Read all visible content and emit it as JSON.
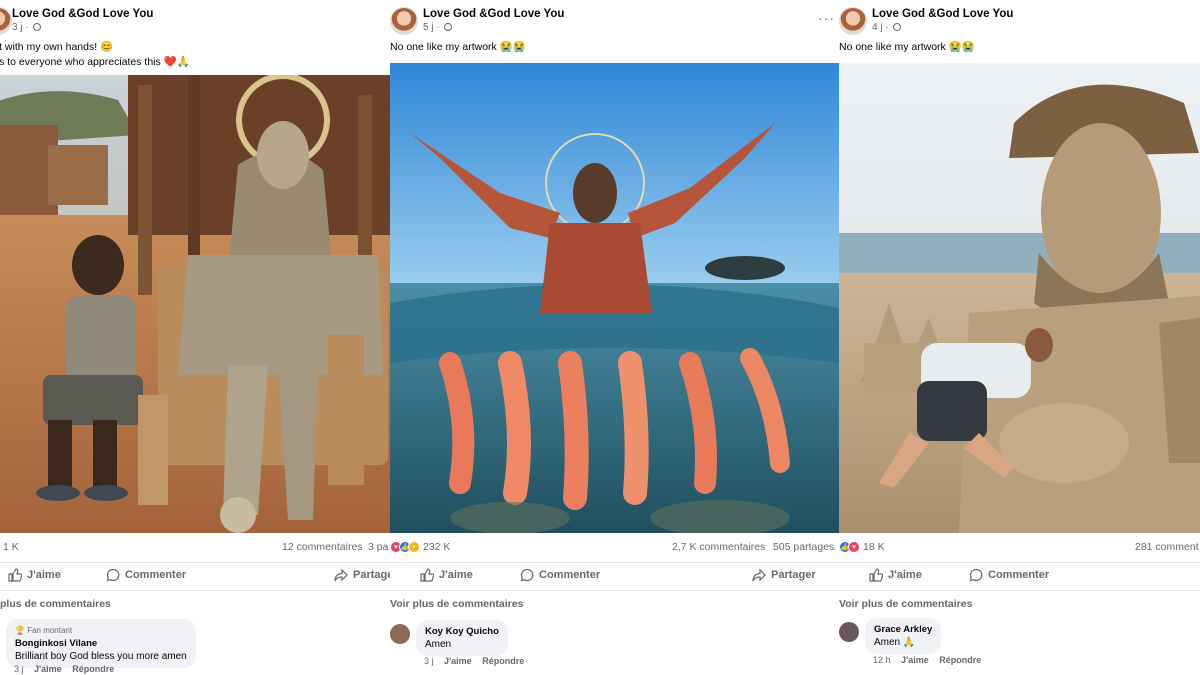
{
  "posts": [
    {
      "author": "Love God &God Love You",
      "time": "3 j",
      "caption_lines": [
        "e it with my own hands! 😊",
        "nks to everyone who appreciates this ❤️🙏"
      ],
      "image_desc": "coin-statue-photo",
      "reaction_count": "1 K",
      "comment_count": "12 commentaires",
      "share_count": "3 pa",
      "like_label": "J'aime",
      "comment_label": "Commenter",
      "share_label": "Partage",
      "more_comments": "plus de commentaires",
      "comment": {
        "badge": "Fan montant",
        "author": "Bonginkosi Vilane",
        "text": "Brilliant boy God bless you more amen",
        "time": "3 j",
        "like": "J'aime",
        "reply": "Répondre"
      }
    },
    {
      "author": "Love God &God Love You",
      "time": "5 j",
      "caption_lines": [
        "No one like my artwork 😭😭"
      ],
      "reaction_count": "232 K",
      "comment_count": "2,7 K commentaires",
      "share_count": "505 partages",
      "like_label": "J'aime",
      "comment_label": "Commenter",
      "share_label": "Partager",
      "more_comments": "Voir plus de commentaires",
      "comment": {
        "author": "Koy Koy Quicho",
        "text": "Amen",
        "time": "3 j",
        "like": "J'aime",
        "reply": "Répondre"
      }
    },
    {
      "author": "Love God &God Love You",
      "time": "4 j",
      "caption_lines": [
        "No one like my artwork 😭😭"
      ],
      "reaction_count": "18 K",
      "comment_count": "281 comment",
      "like_label": "J'aime",
      "comment_label": "Commenter",
      "more_comments": "Voir plus de commentaires",
      "comment": {
        "author": "Grace Arkley",
        "text": "Amen 🙏",
        "time": "12 h",
        "like": "J'aime",
        "reply": "Répondre"
      }
    }
  ],
  "colors": {
    "text_secondary": "#65676b",
    "like_blue": "#1877f2",
    "love_red": "#f33e58",
    "bubble_bg": "#f0f2f5"
  }
}
